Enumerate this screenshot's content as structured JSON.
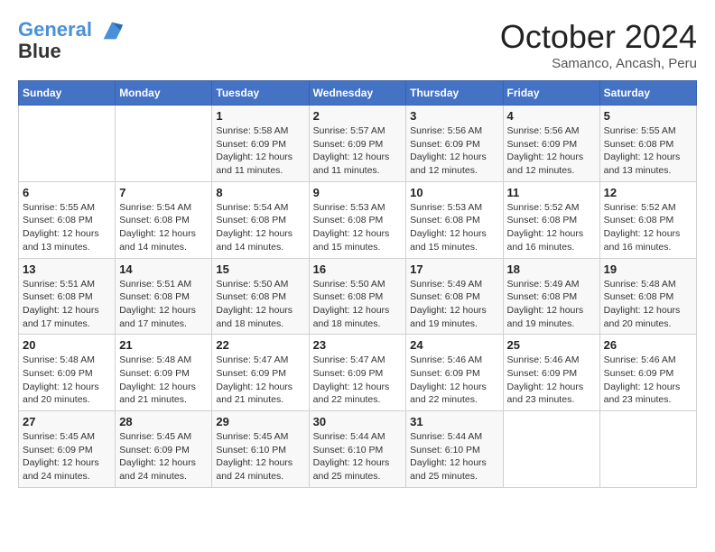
{
  "header": {
    "logo_line1": "General",
    "logo_line2": "Blue",
    "month": "October 2024",
    "location": "Samanco, Ancash, Peru"
  },
  "days_of_week": [
    "Sunday",
    "Monday",
    "Tuesday",
    "Wednesday",
    "Thursday",
    "Friday",
    "Saturday"
  ],
  "weeks": [
    [
      {
        "day": "",
        "info": ""
      },
      {
        "day": "",
        "info": ""
      },
      {
        "day": "1",
        "info": "Sunrise: 5:58 AM\nSunset: 6:09 PM\nDaylight: 12 hours and 11 minutes."
      },
      {
        "day": "2",
        "info": "Sunrise: 5:57 AM\nSunset: 6:09 PM\nDaylight: 12 hours and 11 minutes."
      },
      {
        "day": "3",
        "info": "Sunrise: 5:56 AM\nSunset: 6:09 PM\nDaylight: 12 hours and 12 minutes."
      },
      {
        "day": "4",
        "info": "Sunrise: 5:56 AM\nSunset: 6:09 PM\nDaylight: 12 hours and 12 minutes."
      },
      {
        "day": "5",
        "info": "Sunrise: 5:55 AM\nSunset: 6:08 PM\nDaylight: 12 hours and 13 minutes."
      }
    ],
    [
      {
        "day": "6",
        "info": "Sunrise: 5:55 AM\nSunset: 6:08 PM\nDaylight: 12 hours and 13 minutes."
      },
      {
        "day": "7",
        "info": "Sunrise: 5:54 AM\nSunset: 6:08 PM\nDaylight: 12 hours and 14 minutes."
      },
      {
        "day": "8",
        "info": "Sunrise: 5:54 AM\nSunset: 6:08 PM\nDaylight: 12 hours and 14 minutes."
      },
      {
        "day": "9",
        "info": "Sunrise: 5:53 AM\nSunset: 6:08 PM\nDaylight: 12 hours and 15 minutes."
      },
      {
        "day": "10",
        "info": "Sunrise: 5:53 AM\nSunset: 6:08 PM\nDaylight: 12 hours and 15 minutes."
      },
      {
        "day": "11",
        "info": "Sunrise: 5:52 AM\nSunset: 6:08 PM\nDaylight: 12 hours and 16 minutes."
      },
      {
        "day": "12",
        "info": "Sunrise: 5:52 AM\nSunset: 6:08 PM\nDaylight: 12 hours and 16 minutes."
      }
    ],
    [
      {
        "day": "13",
        "info": "Sunrise: 5:51 AM\nSunset: 6:08 PM\nDaylight: 12 hours and 17 minutes."
      },
      {
        "day": "14",
        "info": "Sunrise: 5:51 AM\nSunset: 6:08 PM\nDaylight: 12 hours and 17 minutes."
      },
      {
        "day": "15",
        "info": "Sunrise: 5:50 AM\nSunset: 6:08 PM\nDaylight: 12 hours and 18 minutes."
      },
      {
        "day": "16",
        "info": "Sunrise: 5:50 AM\nSunset: 6:08 PM\nDaylight: 12 hours and 18 minutes."
      },
      {
        "day": "17",
        "info": "Sunrise: 5:49 AM\nSunset: 6:08 PM\nDaylight: 12 hours and 19 minutes."
      },
      {
        "day": "18",
        "info": "Sunrise: 5:49 AM\nSunset: 6:08 PM\nDaylight: 12 hours and 19 minutes."
      },
      {
        "day": "19",
        "info": "Sunrise: 5:48 AM\nSunset: 6:08 PM\nDaylight: 12 hours and 20 minutes."
      }
    ],
    [
      {
        "day": "20",
        "info": "Sunrise: 5:48 AM\nSunset: 6:09 PM\nDaylight: 12 hours and 20 minutes."
      },
      {
        "day": "21",
        "info": "Sunrise: 5:48 AM\nSunset: 6:09 PM\nDaylight: 12 hours and 21 minutes."
      },
      {
        "day": "22",
        "info": "Sunrise: 5:47 AM\nSunset: 6:09 PM\nDaylight: 12 hours and 21 minutes."
      },
      {
        "day": "23",
        "info": "Sunrise: 5:47 AM\nSunset: 6:09 PM\nDaylight: 12 hours and 22 minutes."
      },
      {
        "day": "24",
        "info": "Sunrise: 5:46 AM\nSunset: 6:09 PM\nDaylight: 12 hours and 22 minutes."
      },
      {
        "day": "25",
        "info": "Sunrise: 5:46 AM\nSunset: 6:09 PM\nDaylight: 12 hours and 23 minutes."
      },
      {
        "day": "26",
        "info": "Sunrise: 5:46 AM\nSunset: 6:09 PM\nDaylight: 12 hours and 23 minutes."
      }
    ],
    [
      {
        "day": "27",
        "info": "Sunrise: 5:45 AM\nSunset: 6:09 PM\nDaylight: 12 hours and 24 minutes."
      },
      {
        "day": "28",
        "info": "Sunrise: 5:45 AM\nSunset: 6:09 PM\nDaylight: 12 hours and 24 minutes."
      },
      {
        "day": "29",
        "info": "Sunrise: 5:45 AM\nSunset: 6:10 PM\nDaylight: 12 hours and 24 minutes."
      },
      {
        "day": "30",
        "info": "Sunrise: 5:44 AM\nSunset: 6:10 PM\nDaylight: 12 hours and 25 minutes."
      },
      {
        "day": "31",
        "info": "Sunrise: 5:44 AM\nSunset: 6:10 PM\nDaylight: 12 hours and 25 minutes."
      },
      {
        "day": "",
        "info": ""
      },
      {
        "day": "",
        "info": ""
      }
    ]
  ]
}
